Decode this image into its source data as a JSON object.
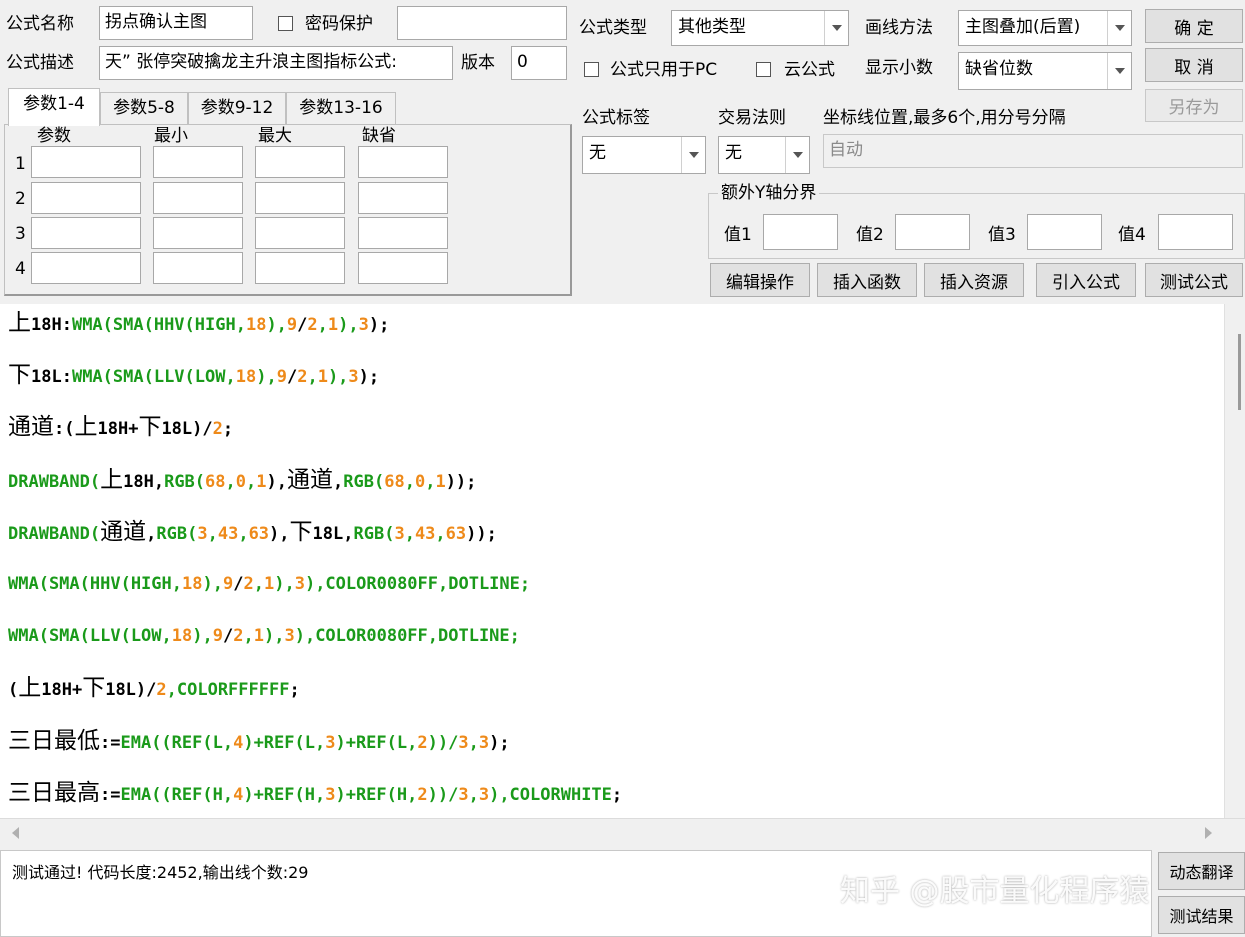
{
  "header": {
    "formula_name_label": "公式名称",
    "formula_name_value": "拐点确认主图",
    "password_label": "密码保护",
    "formula_type_label": "公式类型",
    "formula_type_value": "其他类型",
    "draw_method_label": "画线方法",
    "draw_method_value": "主图叠加(后置)",
    "ok_button": "确 定",
    "cancel_button": "取 消",
    "save_as_button": "另存为",
    "description_label": "公式描述",
    "description_value": "天” 张停突破擒龙主升浪主图指标公式:",
    "version_label": "版本",
    "version_value": "0",
    "pc_only_label": "公式只用于PC",
    "cloud_label": "云公式",
    "decimals_label": "显示小数",
    "decimals_value": "缺省位数"
  },
  "params": {
    "tabs": [
      "参数1-4",
      "参数5-8",
      "参数9-12",
      "参数13-16"
    ],
    "columns": [
      "参数",
      "最小",
      "最大",
      "缺省"
    ],
    "rows": [
      "1",
      "2",
      "3",
      "4"
    ]
  },
  "options": {
    "tag_label": "公式标签",
    "tag_value": "无",
    "trade_rule_label": "交易法则",
    "trade_rule_value": "无",
    "axis_label": "坐标线位置,最多6个,用分号分隔",
    "axis_value": "自动",
    "y_group_label": "额外Y轴分界",
    "y_values": [
      "值1",
      "值2",
      "值3",
      "值4"
    ]
  },
  "actions": [
    "编辑操作",
    "插入函数",
    "插入资源",
    "引入公式",
    "测试公式"
  ],
  "code_lines": [
    [
      [
        "上",
        "k",
        1
      ],
      [
        "18H:",
        "k",
        0
      ],
      [
        "WMA(SMA(HHV(HIGH,",
        "g",
        0
      ],
      [
        "18",
        "o",
        0
      ],
      [
        "),",
        "g",
        0
      ],
      [
        "9",
        "o",
        0
      ],
      [
        "/",
        "k",
        0
      ],
      [
        "2",
        "o",
        0
      ],
      [
        ",",
        "g",
        0
      ],
      [
        "1",
        "o",
        0
      ],
      [
        "),",
        "g",
        0
      ],
      [
        "3",
        "o",
        0
      ],
      [
        ");",
        "k",
        0
      ]
    ],
    [
      [
        "下",
        "k",
        1
      ],
      [
        "18L:",
        "k",
        0
      ],
      [
        "WMA(SMA(LLV(LOW,",
        "g",
        0
      ],
      [
        "18",
        "o",
        0
      ],
      [
        "),",
        "g",
        0
      ],
      [
        "9",
        "o",
        0
      ],
      [
        "/",
        "k",
        0
      ],
      [
        "2",
        "o",
        0
      ],
      [
        ",",
        "g",
        0
      ],
      [
        "1",
        "o",
        0
      ],
      [
        "),",
        "g",
        0
      ],
      [
        "3",
        "o",
        0
      ],
      [
        ");",
        "k",
        0
      ]
    ],
    [
      [
        "通道",
        "k",
        1
      ],
      [
        ":(",
        "k",
        0
      ],
      [
        "上",
        "k",
        1
      ],
      [
        "18H+",
        "k",
        0
      ],
      [
        "下",
        "k",
        1
      ],
      [
        "18L)/",
        "k",
        0
      ],
      [
        "2",
        "o",
        0
      ],
      [
        ";",
        "k",
        0
      ]
    ],
    [
      [
        "DRAWBAND(",
        "g",
        0
      ],
      [
        "上",
        "k",
        1
      ],
      [
        "18H,",
        "k",
        0
      ],
      [
        "RGB(",
        "g",
        0
      ],
      [
        "68",
        "o",
        0
      ],
      [
        ",",
        "g",
        0
      ],
      [
        "0",
        "o",
        0
      ],
      [
        ",",
        "g",
        0
      ],
      [
        "1",
        "o",
        0
      ],
      [
        "),",
        "k",
        0
      ],
      [
        "通道",
        "k",
        1
      ],
      [
        ",",
        "k",
        0
      ],
      [
        "RGB(",
        "g",
        0
      ],
      [
        "68",
        "o",
        0
      ],
      [
        ",",
        "g",
        0
      ],
      [
        "0",
        "o",
        0
      ],
      [
        ",",
        "g",
        0
      ],
      [
        "1",
        "o",
        0
      ],
      [
        "));",
        "k",
        0
      ]
    ],
    [
      [
        "DRAWBAND(",
        "g",
        0
      ],
      [
        "通道",
        "k",
        1
      ],
      [
        ",",
        "k",
        0
      ],
      [
        "RGB(",
        "g",
        0
      ],
      [
        "3",
        "o",
        0
      ],
      [
        ",",
        "g",
        0
      ],
      [
        "43",
        "o",
        0
      ],
      [
        ",",
        "g",
        0
      ],
      [
        "63",
        "o",
        0
      ],
      [
        "),",
        "k",
        0
      ],
      [
        "下",
        "k",
        1
      ],
      [
        "18L,",
        "k",
        0
      ],
      [
        "RGB(",
        "g",
        0
      ],
      [
        "3",
        "o",
        0
      ],
      [
        ",",
        "g",
        0
      ],
      [
        "43",
        "o",
        0
      ],
      [
        ",",
        "g",
        0
      ],
      [
        "63",
        "o",
        0
      ],
      [
        "));",
        "k",
        0
      ]
    ],
    [
      [
        "WMA(SMA(HHV(HIGH,",
        "g",
        0
      ],
      [
        "18",
        "o",
        0
      ],
      [
        "),",
        "g",
        0
      ],
      [
        "9",
        "o",
        0
      ],
      [
        "/",
        "k",
        0
      ],
      [
        "2",
        "o",
        0
      ],
      [
        ",",
        "g",
        0
      ],
      [
        "1",
        "o",
        0
      ],
      [
        "),",
        "g",
        0
      ],
      [
        "3",
        "o",
        0
      ],
      [
        "),COLOR0080FF,DOTLINE;",
        "g",
        0
      ]
    ],
    [
      [
        "WMA(SMA(LLV(LOW,",
        "g",
        0
      ],
      [
        "18",
        "o",
        0
      ],
      [
        "),",
        "g",
        0
      ],
      [
        "9",
        "o",
        0
      ],
      [
        "/",
        "k",
        0
      ],
      [
        "2",
        "o",
        0
      ],
      [
        ",",
        "g",
        0
      ],
      [
        "1",
        "o",
        0
      ],
      [
        "),",
        "g",
        0
      ],
      [
        "3",
        "o",
        0
      ],
      [
        "),COLOR0080FF,DOTLINE;",
        "g",
        0
      ]
    ],
    [
      [
        "(",
        "k",
        0
      ],
      [
        "上",
        "k",
        1
      ],
      [
        "18H+",
        "k",
        0
      ],
      [
        "下",
        "k",
        1
      ],
      [
        "18L)/",
        "k",
        0
      ],
      [
        "2",
        "o",
        0
      ],
      [
        ",COLORFFFFFF",
        "g",
        0
      ],
      [
        ";",
        "k",
        0
      ]
    ],
    [
      [
        "三日最低",
        "k",
        1
      ],
      [
        ":=",
        "k",
        0
      ],
      [
        "EMA((REF(L,",
        "g",
        0
      ],
      [
        "4",
        "o",
        0
      ],
      [
        ")+REF(L,",
        "g",
        0
      ],
      [
        "3",
        "o",
        0
      ],
      [
        ")+REF(L,",
        "g",
        0
      ],
      [
        "2",
        "o",
        0
      ],
      [
        "))/",
        "g",
        0
      ],
      [
        "3",
        "o",
        0
      ],
      [
        ",",
        "g",
        0
      ],
      [
        "3",
        "o",
        0
      ],
      [
        ");",
        "k",
        0
      ]
    ],
    [
      [
        "三日最高",
        "k",
        1
      ],
      [
        ":=",
        "k",
        0
      ],
      [
        "EMA((REF(H,",
        "g",
        0
      ],
      [
        "4",
        "o",
        0
      ],
      [
        ")+REF(H,",
        "g",
        0
      ],
      [
        "3",
        "o",
        0
      ],
      [
        ")+REF(H,",
        "g",
        0
      ],
      [
        "2",
        "o",
        0
      ],
      [
        "))/",
        "g",
        0
      ],
      [
        "3",
        "o",
        0
      ],
      [
        ",",
        "g",
        0
      ],
      [
        "3",
        "o",
        0
      ],
      [
        "),COLORWHITE",
        "g",
        0
      ],
      [
        ";",
        "k",
        0
      ]
    ]
  ],
  "colors": {
    "keyword": "#1a9a1a",
    "number": "#ee8a1a",
    "plain": "#000000"
  },
  "status_text": "测试通过! 代码长度:2452,输出线个数:29",
  "side_buttons": {
    "translate": "动态翻译",
    "test_result": "测试结果"
  },
  "watermark": "知乎 @股市量化程序猿"
}
